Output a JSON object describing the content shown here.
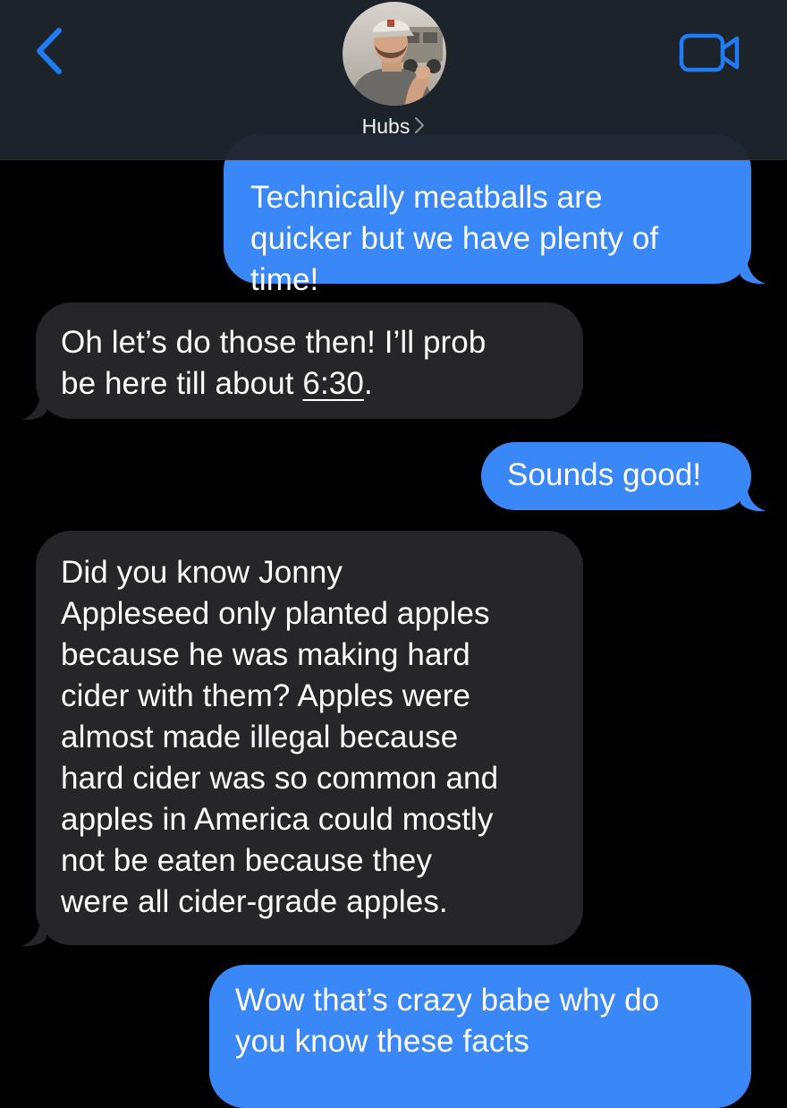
{
  "header": {
    "contact_name": "Hubs",
    "back_icon": "chevron-left-icon",
    "video_icon": "video-camera-icon",
    "accent_color": "#1f7cf6"
  },
  "colors": {
    "outgoing_bubble": "#3a87f7",
    "incoming_bubble": "#262628",
    "background": "#000000"
  },
  "messages": [
    {
      "direction": "outgoing",
      "text_lines": [
        "Technically meatballs are",
        "quicker but we have plenty of",
        "time!"
      ]
    },
    {
      "direction": "incoming",
      "text_line1": "Oh let’s do those then! I’ll prob",
      "text_line2_prefix": "be here till about ",
      "time_link": "6:30",
      "text_line2_suffix": "."
    },
    {
      "direction": "outgoing",
      "text": "Sounds good!"
    },
    {
      "direction": "incoming",
      "text_lines": [
        "Did you know Jonny",
        "Appleseed only planted apples",
        "because he was making hard",
        "cider with them? Apples were",
        "almost made illegal because",
        "hard cider was so common and",
        "apples in America could mostly",
        "not be eaten because they",
        "were all cider-grade apples."
      ]
    },
    {
      "direction": "outgoing",
      "text_lines": [
        "Wow that’s crazy babe why do",
        "you know these facts"
      ]
    }
  ]
}
